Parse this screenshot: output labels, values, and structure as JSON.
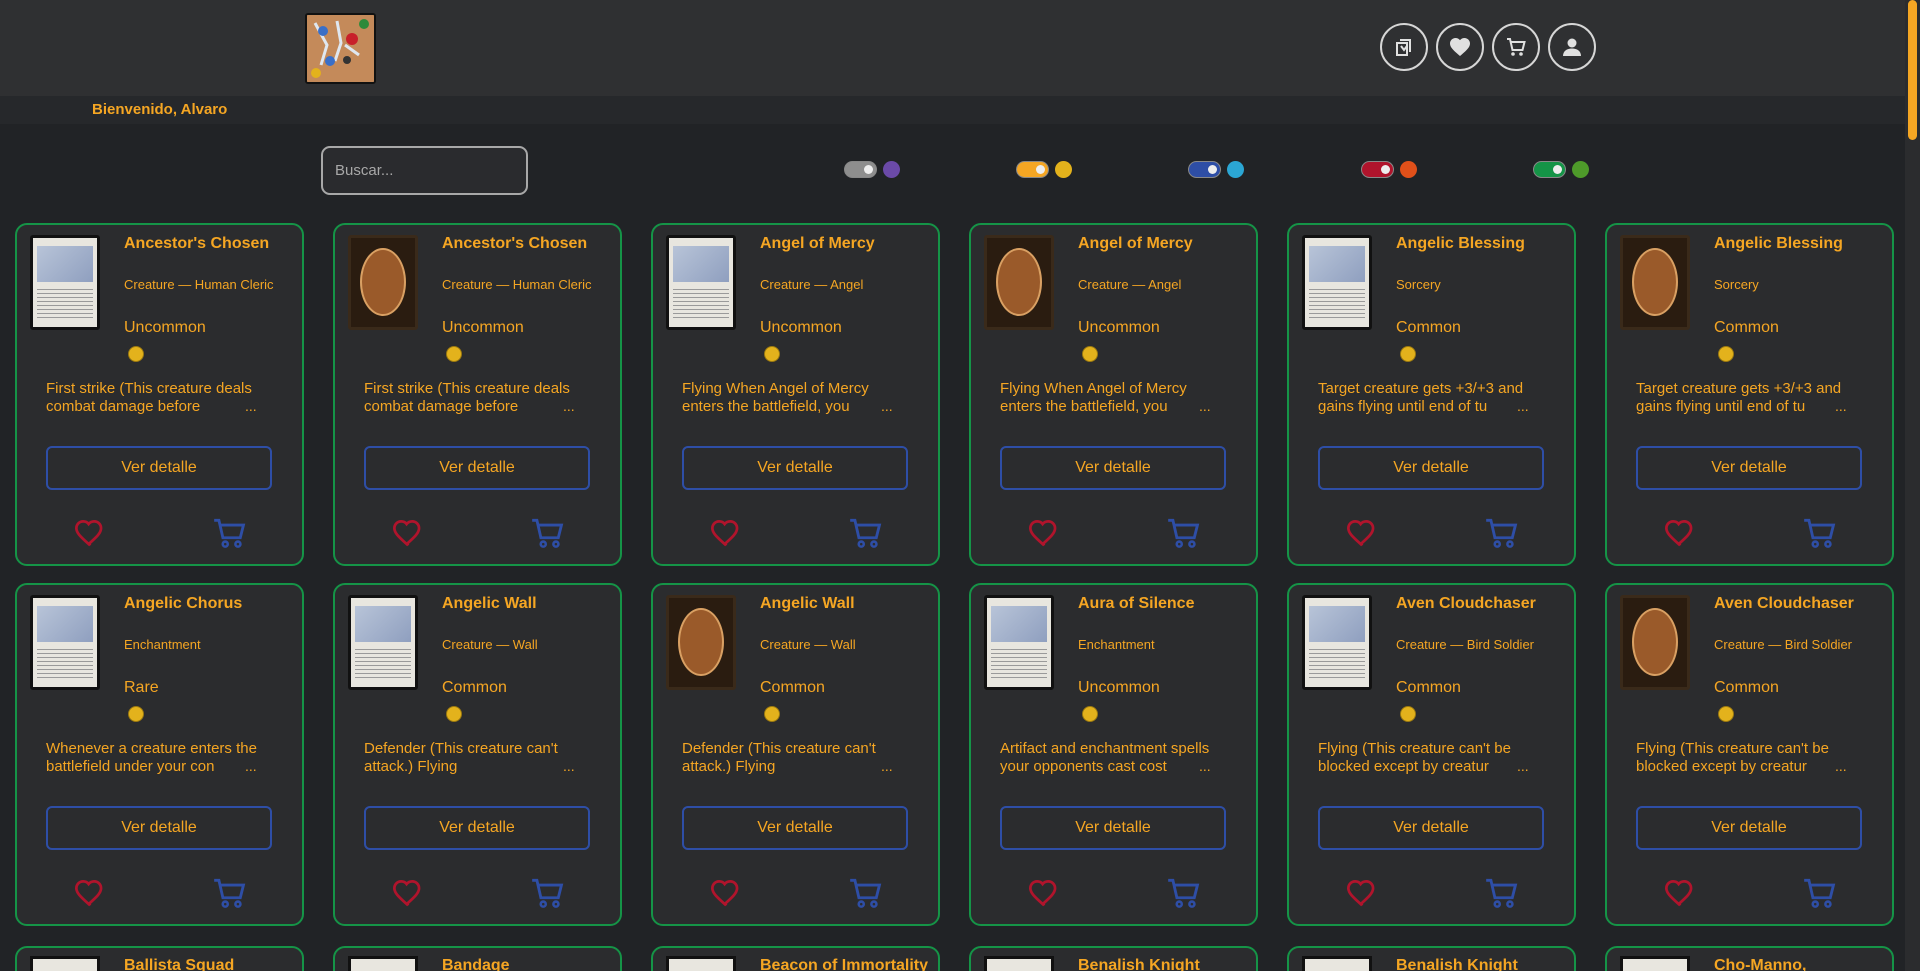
{
  "header": {
    "logo_icon": "mana-logo-icon",
    "nav_icons": [
      "card-pack-icon",
      "heart-icon",
      "cart-icon",
      "user-icon"
    ],
    "welcome": "Bienvenido, Alvaro"
  },
  "search": {
    "placeholder": "Buscar..."
  },
  "filters": [
    {
      "name": "black",
      "color": "#8e8e8e",
      "mana": "#6b4aa8"
    },
    {
      "name": "white",
      "color": "#f5a623",
      "mana": "#e3b21c"
    },
    {
      "name": "blue",
      "color": "#2e4ea6",
      "mana": "#2ba6d4"
    },
    {
      "name": "red",
      "color": "#b0142c",
      "mana": "#e0501a"
    },
    {
      "name": "green",
      "color": "#159447",
      "mana": "#4e9a2a"
    }
  ],
  "cards": [
    {
      "title": "Ancestor's Chosen",
      "type": "Creature — Human Cleric",
      "rarity": "Uncommon",
      "desc": "First strike (This creature deals combat damage before",
      "button": "Ver detalle",
      "art": "front"
    },
    {
      "title": "Ancestor's Chosen",
      "type": "Creature — Human Cleric",
      "rarity": "Uncommon",
      "desc": "First strike (This creature deals combat damage before",
      "button": "Ver detalle",
      "art": "back"
    },
    {
      "title": "Angel of Mercy",
      "type": "Creature — Angel",
      "rarity": "Uncommon",
      "desc": "Flying When Angel of Mercy enters the battlefield, you",
      "button": "Ver detalle",
      "art": "front"
    },
    {
      "title": "Angel of Mercy",
      "type": "Creature — Angel",
      "rarity": "Uncommon",
      "desc": "Flying When Angel of Mercy enters the battlefield, you",
      "button": "Ver detalle",
      "art": "back"
    },
    {
      "title": "Angelic Blessing",
      "type": "Sorcery",
      "rarity": "Common",
      "desc": "Target creature gets +3/+3 and gains flying until end of tu",
      "button": "Ver detalle",
      "art": "front"
    },
    {
      "title": "Angelic Blessing",
      "type": "Sorcery",
      "rarity": "Common",
      "desc": "Target creature gets +3/+3 and gains flying until end of tu",
      "button": "Ver detalle",
      "art": "back"
    },
    {
      "title": "Angelic Chorus",
      "type": "Enchantment",
      "rarity": "Rare",
      "desc": "Whenever a creature enters the battlefield under your con",
      "button": "Ver detalle",
      "art": "front"
    },
    {
      "title": "Angelic Wall",
      "type": "Creature — Wall",
      "rarity": "Common",
      "desc": "Defender (This creature can't attack.) Flying",
      "button": "Ver detalle",
      "art": "front"
    },
    {
      "title": "Angelic Wall",
      "type": "Creature — Wall",
      "rarity": "Common",
      "desc": "Defender (This creature can't attack.) Flying",
      "button": "Ver detalle",
      "art": "back"
    },
    {
      "title": "Aura of Silence",
      "type": "Enchantment",
      "rarity": "Uncommon",
      "desc": "Artifact and enchantment spells your opponents cast cost",
      "button": "Ver detalle",
      "art": "front"
    },
    {
      "title": "Aven Cloudchaser",
      "type": "Creature — Bird Soldier",
      "rarity": "Common",
      "desc": "Flying (This creature can't be blocked except by creatur",
      "button": "Ver detalle",
      "art": "front"
    },
    {
      "title": "Aven Cloudchaser",
      "type": "Creature — Bird Soldier",
      "rarity": "Common",
      "desc": "Flying (This creature can't be blocked except by creatur",
      "button": "Ver detalle",
      "art": "back"
    }
  ],
  "partial_cards": [
    "Ballista Squad",
    "Bandage",
    "Beacon of Immortality",
    "Benalish Knight",
    "Benalish Knight",
    "Cho-Manno,"
  ],
  "ellipsis": "..."
}
